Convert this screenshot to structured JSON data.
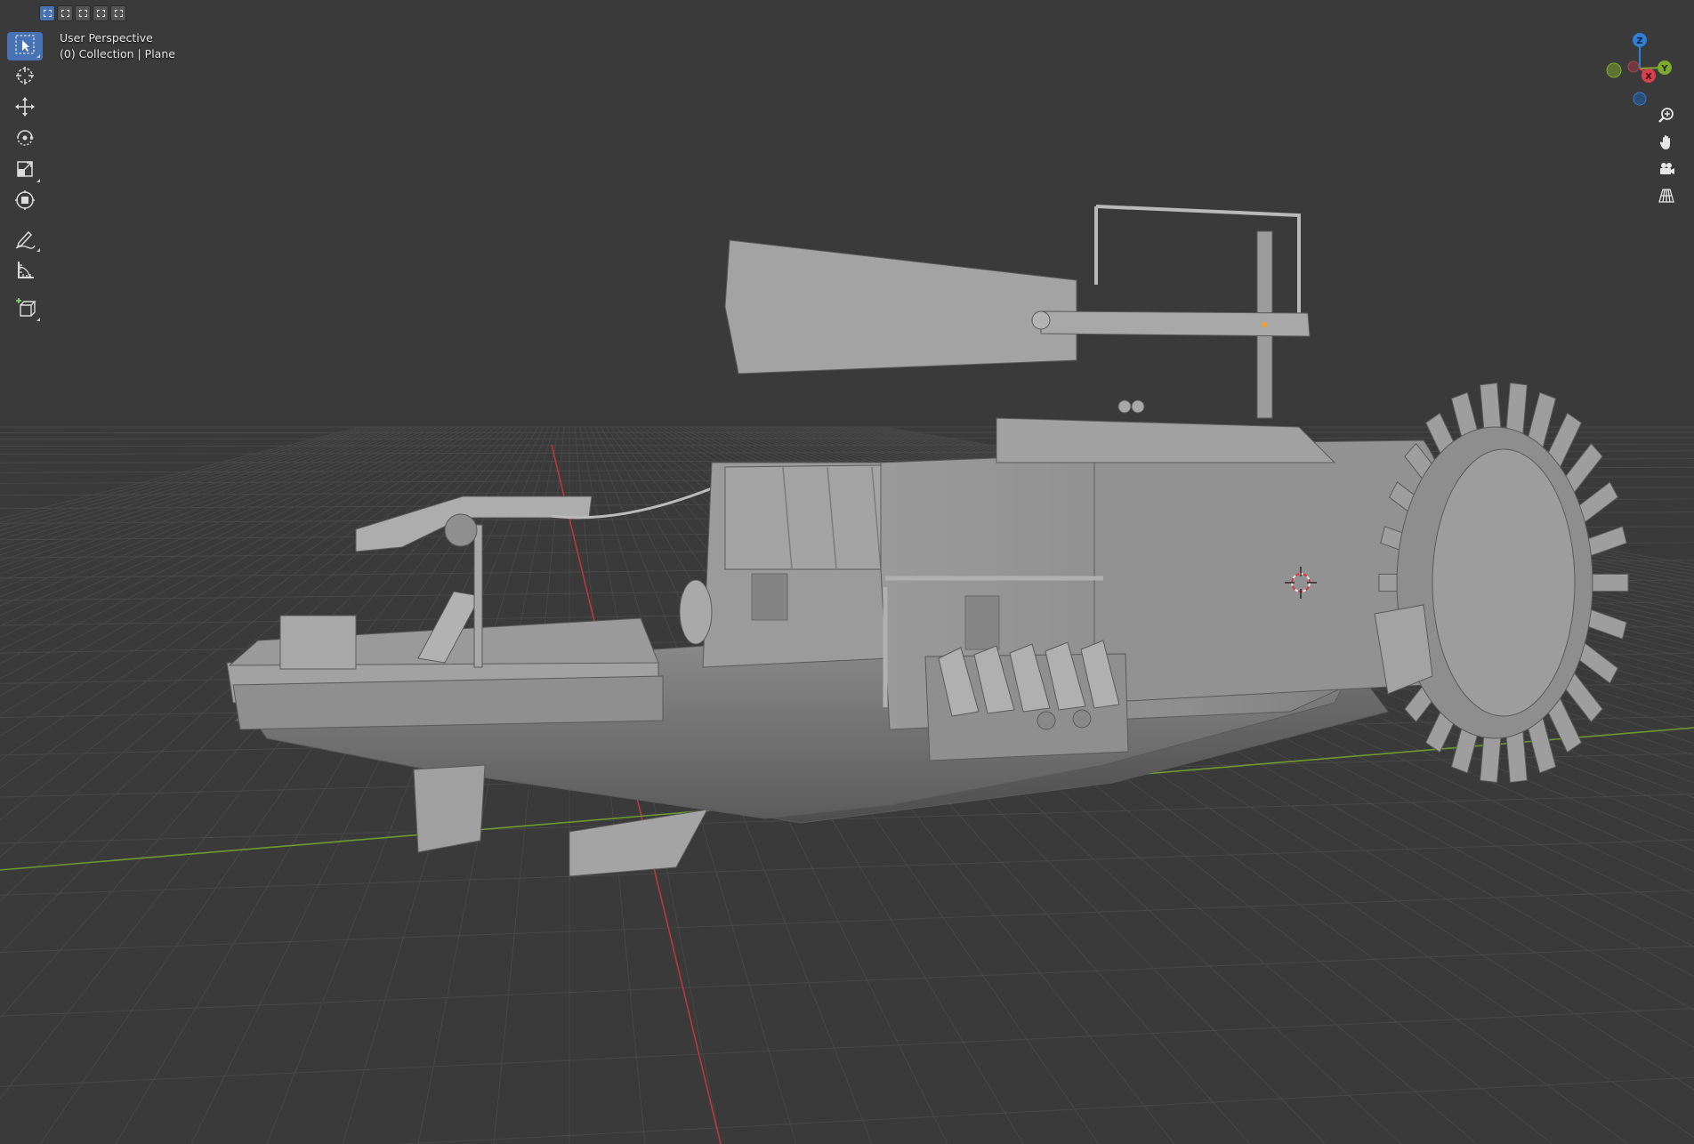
{
  "viewport": {
    "view_name": "User Perspective",
    "collection_info": "(0) Collection | Plane",
    "background": "#3a3a3a",
    "grid_color": "#474747",
    "x_axis_color": "#b8383b",
    "y_axis_color": "#6d9a2e",
    "model_color": "#8c8c8c"
  },
  "header": {
    "selection_modes": [
      {
        "name": "select-box-new",
        "active": true
      },
      {
        "name": "select-box-extend",
        "active": false
      },
      {
        "name": "select-box-subtract",
        "active": false
      },
      {
        "name": "select-box-invert",
        "active": false
      },
      {
        "name": "select-box-intersect",
        "active": false
      }
    ]
  },
  "toolbar": {
    "tools": [
      {
        "name": "select-box-tool",
        "icon": "cursor-box-icon",
        "active": true
      },
      {
        "name": "cursor-tool",
        "icon": "crosshair-cursor-icon",
        "active": false
      },
      {
        "name": "move-tool",
        "icon": "move-arrows-icon",
        "active": false
      },
      {
        "name": "rotate-tool",
        "icon": "rotate-icon",
        "active": false
      },
      {
        "name": "scale-tool",
        "icon": "scale-icon",
        "active": false
      },
      {
        "name": "transform-tool",
        "icon": "transform-icon",
        "active": false
      },
      {
        "name": "annotate-tool",
        "icon": "pencil-annotate-icon",
        "active": false
      },
      {
        "name": "measure-tool",
        "icon": "ruler-measure-icon",
        "active": false
      },
      {
        "name": "add-cube-tool",
        "icon": "add-cube-icon",
        "active": false
      }
    ]
  },
  "navigation": {
    "gizmo_axes": {
      "x": {
        "label": "X",
        "color": "#d7404c"
      },
      "y": {
        "label": "Y",
        "color": "#7dab2d"
      },
      "z": {
        "label": "Z",
        "color": "#2e7fd6"
      }
    },
    "buttons": [
      {
        "name": "zoom-button",
        "icon": "zoom-magnifier-icon"
      },
      {
        "name": "pan-button",
        "icon": "hand-pan-icon"
      },
      {
        "name": "camera-view-button",
        "icon": "camera-icon"
      },
      {
        "name": "perspective-toggle-button",
        "icon": "grid-perspective-icon"
      }
    ]
  }
}
